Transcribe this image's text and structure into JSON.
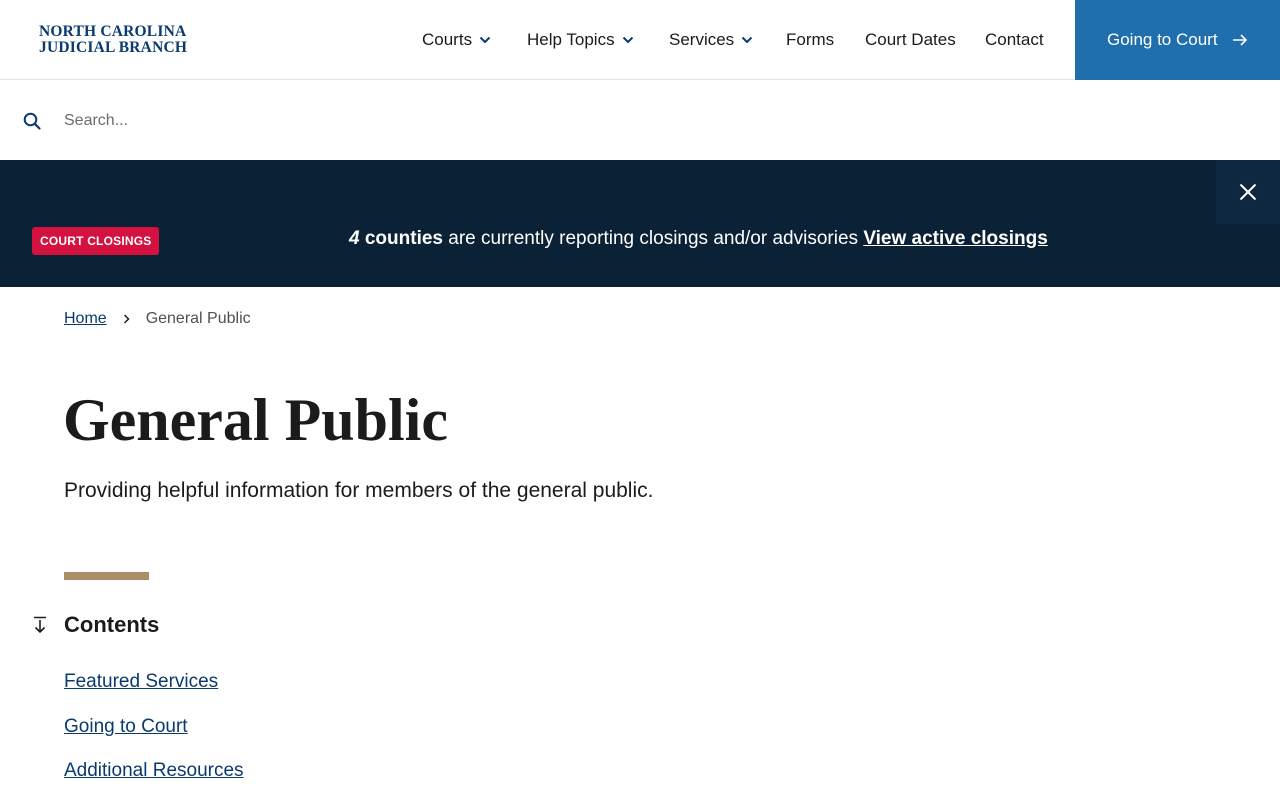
{
  "header": {
    "logo_line1": "NORTH CAROLINA",
    "logo_line2": "JUDICIAL BRANCH",
    "nav": {
      "courts": "Courts",
      "help_topics": "Help Topics",
      "services": "Services",
      "forms": "Forms",
      "court_dates": "Court Dates",
      "contact": "Contact"
    },
    "cta_label": "Going to Court"
  },
  "search": {
    "placeholder": "Search...",
    "value": ""
  },
  "alert": {
    "badge": "COURT CLOSINGS",
    "count": "4",
    "counties": "counties",
    "message": "are currently reporting closings and/or advisories",
    "link": "View active closings"
  },
  "breadcrumb": {
    "home": "Home",
    "current": "General Public"
  },
  "page": {
    "title": "General Public",
    "lead": "Providing helpful information for members of the general public."
  },
  "contents": {
    "title": "Contents",
    "items": [
      "Featured Services",
      "Going to Court",
      "Additional Resources"
    ]
  },
  "colors": {
    "brand": "#0b3a6e",
    "cta": "#1f6fae",
    "alert_bg": "#0b2236",
    "badge": "#d3123f",
    "accent": "#a98e68"
  }
}
